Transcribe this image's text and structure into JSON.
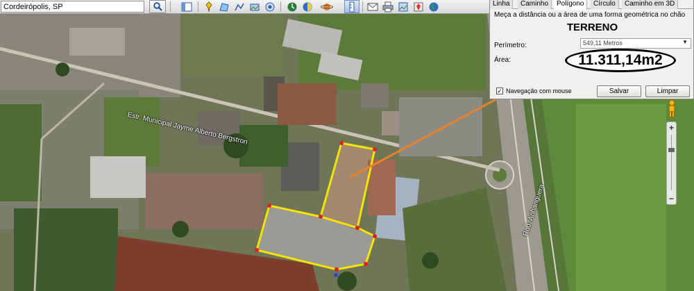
{
  "search": {
    "value": "Cordeirópolis, SP"
  },
  "toolbar": {
    "buttons": [
      "search-icon",
      "sidebar-icon",
      "placemark-icon",
      "polygon-icon",
      "path-icon",
      "overlay-icon",
      "tour-icon",
      "historical-imagery-icon",
      "sunlight-icon",
      "planets-icon",
      "ruler-icon",
      "email-icon",
      "print-icon",
      "save-image-icon",
      "maps-icon",
      "earth-icon"
    ]
  },
  "measure_dialog": {
    "tabs": [
      "Linha",
      "Caminho",
      "Polígono",
      "Círculo",
      "Caminho em 3D"
    ],
    "active_tab": "Polígono",
    "instruction": "Meça a distância ou a área de uma forma geométrica no chão",
    "shape_title": "TERRENO",
    "perimeter_label": "Perímetro:",
    "perimeter_value": "549,11 Metros",
    "area_label": "Área:",
    "area_value": "11.311,14m2",
    "navigation_label": "Navegação com mouse",
    "navigation_checked": true,
    "save_label": "Salvar",
    "clear_label": "Limpar"
  },
  "map": {
    "street_label": "Estr. Municipal Jayme Alberto Bergstron",
    "highway_label": "Rod. Anhanguera",
    "polygon_color": "#f5e400",
    "vertex_color": "#e02020",
    "annotation_line_color": "#e8822a"
  },
  "zoom": {
    "level": 0.72
  }
}
